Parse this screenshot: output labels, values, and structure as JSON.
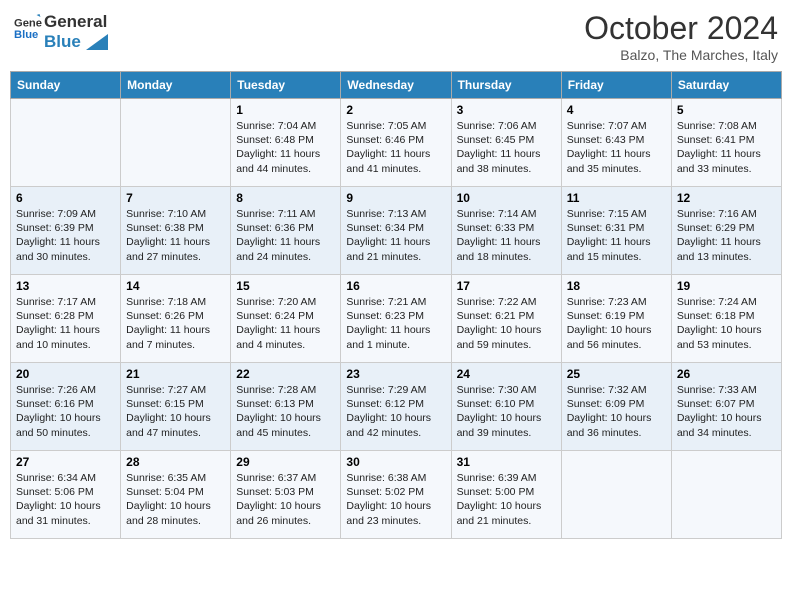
{
  "header": {
    "logo_line1": "General",
    "logo_line2": "Blue",
    "month": "October 2024",
    "location": "Balzo, The Marches, Italy"
  },
  "days_of_week": [
    "Sunday",
    "Monday",
    "Tuesday",
    "Wednesday",
    "Thursday",
    "Friday",
    "Saturday"
  ],
  "weeks": [
    [
      {
        "day": "",
        "info": ""
      },
      {
        "day": "",
        "info": ""
      },
      {
        "day": "1",
        "info": "Sunrise: 7:04 AM\nSunset: 6:48 PM\nDaylight: 11 hours and 44 minutes."
      },
      {
        "day": "2",
        "info": "Sunrise: 7:05 AM\nSunset: 6:46 PM\nDaylight: 11 hours and 41 minutes."
      },
      {
        "day": "3",
        "info": "Sunrise: 7:06 AM\nSunset: 6:45 PM\nDaylight: 11 hours and 38 minutes."
      },
      {
        "day": "4",
        "info": "Sunrise: 7:07 AM\nSunset: 6:43 PM\nDaylight: 11 hours and 35 minutes."
      },
      {
        "day": "5",
        "info": "Sunrise: 7:08 AM\nSunset: 6:41 PM\nDaylight: 11 hours and 33 minutes."
      }
    ],
    [
      {
        "day": "6",
        "info": "Sunrise: 7:09 AM\nSunset: 6:39 PM\nDaylight: 11 hours and 30 minutes."
      },
      {
        "day": "7",
        "info": "Sunrise: 7:10 AM\nSunset: 6:38 PM\nDaylight: 11 hours and 27 minutes."
      },
      {
        "day": "8",
        "info": "Sunrise: 7:11 AM\nSunset: 6:36 PM\nDaylight: 11 hours and 24 minutes."
      },
      {
        "day": "9",
        "info": "Sunrise: 7:13 AM\nSunset: 6:34 PM\nDaylight: 11 hours and 21 minutes."
      },
      {
        "day": "10",
        "info": "Sunrise: 7:14 AM\nSunset: 6:33 PM\nDaylight: 11 hours and 18 minutes."
      },
      {
        "day": "11",
        "info": "Sunrise: 7:15 AM\nSunset: 6:31 PM\nDaylight: 11 hours and 15 minutes."
      },
      {
        "day": "12",
        "info": "Sunrise: 7:16 AM\nSunset: 6:29 PM\nDaylight: 11 hours and 13 minutes."
      }
    ],
    [
      {
        "day": "13",
        "info": "Sunrise: 7:17 AM\nSunset: 6:28 PM\nDaylight: 11 hours and 10 minutes."
      },
      {
        "day": "14",
        "info": "Sunrise: 7:18 AM\nSunset: 6:26 PM\nDaylight: 11 hours and 7 minutes."
      },
      {
        "day": "15",
        "info": "Sunrise: 7:20 AM\nSunset: 6:24 PM\nDaylight: 11 hours and 4 minutes."
      },
      {
        "day": "16",
        "info": "Sunrise: 7:21 AM\nSunset: 6:23 PM\nDaylight: 11 hours and 1 minute."
      },
      {
        "day": "17",
        "info": "Sunrise: 7:22 AM\nSunset: 6:21 PM\nDaylight: 10 hours and 59 minutes."
      },
      {
        "day": "18",
        "info": "Sunrise: 7:23 AM\nSunset: 6:19 PM\nDaylight: 10 hours and 56 minutes."
      },
      {
        "day": "19",
        "info": "Sunrise: 7:24 AM\nSunset: 6:18 PM\nDaylight: 10 hours and 53 minutes."
      }
    ],
    [
      {
        "day": "20",
        "info": "Sunrise: 7:26 AM\nSunset: 6:16 PM\nDaylight: 10 hours and 50 minutes."
      },
      {
        "day": "21",
        "info": "Sunrise: 7:27 AM\nSunset: 6:15 PM\nDaylight: 10 hours and 47 minutes."
      },
      {
        "day": "22",
        "info": "Sunrise: 7:28 AM\nSunset: 6:13 PM\nDaylight: 10 hours and 45 minutes."
      },
      {
        "day": "23",
        "info": "Sunrise: 7:29 AM\nSunset: 6:12 PM\nDaylight: 10 hours and 42 minutes."
      },
      {
        "day": "24",
        "info": "Sunrise: 7:30 AM\nSunset: 6:10 PM\nDaylight: 10 hours and 39 minutes."
      },
      {
        "day": "25",
        "info": "Sunrise: 7:32 AM\nSunset: 6:09 PM\nDaylight: 10 hours and 36 minutes."
      },
      {
        "day": "26",
        "info": "Sunrise: 7:33 AM\nSunset: 6:07 PM\nDaylight: 10 hours and 34 minutes."
      }
    ],
    [
      {
        "day": "27",
        "info": "Sunrise: 6:34 AM\nSunset: 5:06 PM\nDaylight: 10 hours and 31 minutes."
      },
      {
        "day": "28",
        "info": "Sunrise: 6:35 AM\nSunset: 5:04 PM\nDaylight: 10 hours and 28 minutes."
      },
      {
        "day": "29",
        "info": "Sunrise: 6:37 AM\nSunset: 5:03 PM\nDaylight: 10 hours and 26 minutes."
      },
      {
        "day": "30",
        "info": "Sunrise: 6:38 AM\nSunset: 5:02 PM\nDaylight: 10 hours and 23 minutes."
      },
      {
        "day": "31",
        "info": "Sunrise: 6:39 AM\nSunset: 5:00 PM\nDaylight: 10 hours and 21 minutes."
      },
      {
        "day": "",
        "info": ""
      },
      {
        "day": "",
        "info": ""
      }
    ]
  ]
}
